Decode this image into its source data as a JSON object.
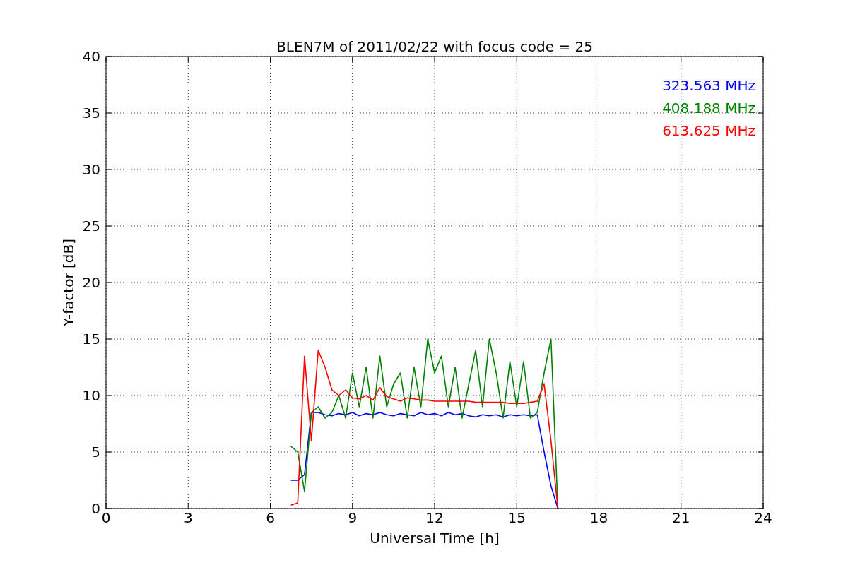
{
  "figure": {
    "chart_data": {
      "type": "line",
      "title": "BLEN7M of 2011/02/22 with focus code = 25",
      "xlabel": "Universal Time [h]",
      "ylabel": "Y-factor [dB]",
      "x": [
        6.75,
        7,
        7.25,
        7.5,
        7.75,
        8,
        8.25,
        8.5,
        8.75,
        9,
        9.25,
        9.5,
        9.75,
        10,
        10.25,
        10.5,
        10.75,
        11,
        11.25,
        11.5,
        11.75,
        12,
        12.25,
        12.5,
        12.75,
        13,
        13.25,
        13.5,
        13.75,
        14,
        14.25,
        14.5,
        14.75,
        15,
        15.25,
        15.5,
        15.75,
        16,
        16.25,
        16.5
      ],
      "series": [
        {
          "name": "323.563 MHz",
          "color": "#0000ff",
          "values": [
            2.5,
            2.5,
            3,
            8.5,
            8.5,
            8.3,
            8.2,
            8.4,
            8.3,
            8.5,
            8.2,
            8.4,
            8.3,
            8.5,
            8.3,
            8.2,
            8.4,
            8.3,
            8.2,
            8.5,
            8.3,
            8.4,
            8.2,
            8.5,
            8.3,
            8.4,
            8.2,
            8.1,
            8.3,
            8.2,
            8.3,
            8.1,
            8.3,
            8.2,
            8.3,
            8.2,
            8.3,
            5,
            2,
            0
          ]
        },
        {
          "name": "408.188 MHz",
          "color": "#008000",
          "values": [
            5.5,
            5,
            1.5,
            8.5,
            9,
            8,
            8.5,
            10,
            8,
            12,
            9,
            12.5,
            8,
            13.5,
            9,
            11,
            12,
            8,
            12.5,
            9,
            15,
            12,
            13.5,
            9,
            12.5,
            8,
            11,
            14,
            9,
            15,
            12,
            8,
            13,
            9,
            13,
            8,
            8.5,
            12,
            15,
            0
          ]
        },
        {
          "name": "613.625 MHz",
          "color": "#ff0000",
          "values": [
            0.3,
            0.5,
            13.5,
            6,
            14,
            12.5,
            10.5,
            10,
            10.5,
            9.8,
            9.7,
            10,
            9.6,
            10.7,
            9.9,
            9.7,
            9.5,
            9.8,
            9.7,
            9.6,
            9.6,
            9.5,
            9.5,
            9.5,
            9.5,
            9.5,
            9.5,
            9.4,
            9.4,
            9.4,
            9.4,
            9.4,
            9.3,
            9.3,
            9.3,
            9.4,
            9.5,
            11,
            6,
            0
          ]
        }
      ],
      "grid": true,
      "xlim": [
        0,
        24
      ],
      "ylim": [
        0,
        40
      ],
      "xticks": [
        0,
        3,
        6,
        9,
        12,
        15,
        18,
        21,
        24
      ],
      "yticks": [
        0,
        5,
        10,
        15,
        20,
        25,
        30,
        35,
        40
      ]
    }
  }
}
